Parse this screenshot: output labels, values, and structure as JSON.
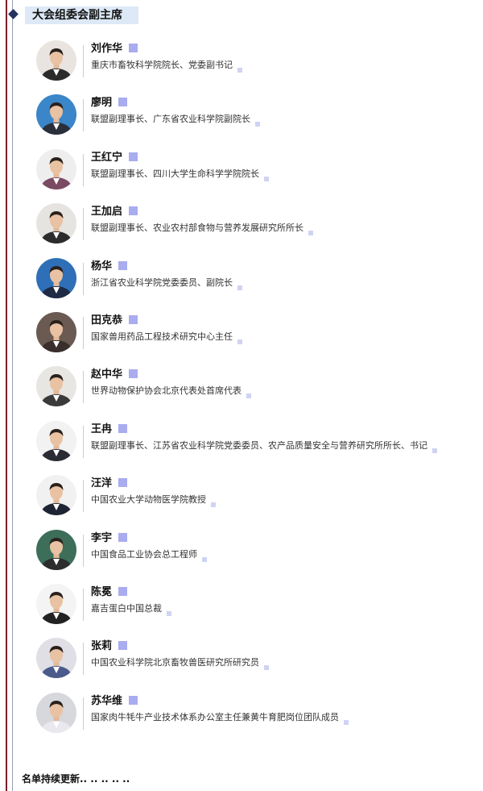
{
  "section": {
    "title": "大会组委会副主席"
  },
  "members": [
    {
      "name": "刘作华",
      "role": "重庆市畜牧科学院院长、党委副书记",
      "photo": "portrait-icon"
    },
    {
      "name": "廖明",
      "role": "联盟副理事长、广东省农业科学院副院长",
      "photo": "portrait-icon"
    },
    {
      "name": "王红宁",
      "role": "联盟副理事长、四川大学生命科学学院院长",
      "photo": "portrait-icon"
    },
    {
      "name": "王加启",
      "role": "联盟副理事长、农业农村部食物与营养发展研究所所长",
      "photo": "portrait-icon"
    },
    {
      "name": "杨华",
      "role": "浙江省农业科学院党委委员、副院长",
      "photo": "portrait-icon"
    },
    {
      "name": "田克恭",
      "role": "国家兽用药品工程技术研究中心主任",
      "photo": "portrait-icon"
    },
    {
      "name": "赵中华",
      "role": "世界动物保护协会北京代表处首席代表",
      "photo": "portrait-icon"
    },
    {
      "name": "王冉",
      "role": "联盟副理事长、江苏省农业科学院党委委员、农产品质量安全与营养研究所所长、书记",
      "photo": "portrait-icon"
    },
    {
      "name": "汪洋",
      "role": "中国农业大学动物医学院教授",
      "photo": "portrait-icon"
    },
    {
      "name": "李宇",
      "role": "中国食品工业协会总工程师",
      "photo": "portrait-icon"
    },
    {
      "name": "陈冕",
      "role": "嘉吉蛋白中国总裁",
      "photo": "portrait-icon"
    },
    {
      "name": "张莉",
      "role": "中国农业科学院北京畜牧兽医研究所研究员",
      "photo": "portrait-icon"
    },
    {
      "name": "苏华维",
      "role": "国家肉牛牦牛产业技术体系办公室主任兼黄牛育肥岗位团队成员",
      "photo": "portrait-icon"
    }
  ],
  "footer": {
    "text": "名单持续更新.. .. .. .. .."
  },
  "colors": {
    "accent_line": "#7a1c2a",
    "title_band": "#dde9f6",
    "name_marker": "#a9acef",
    "diamond": "#24305e"
  }
}
